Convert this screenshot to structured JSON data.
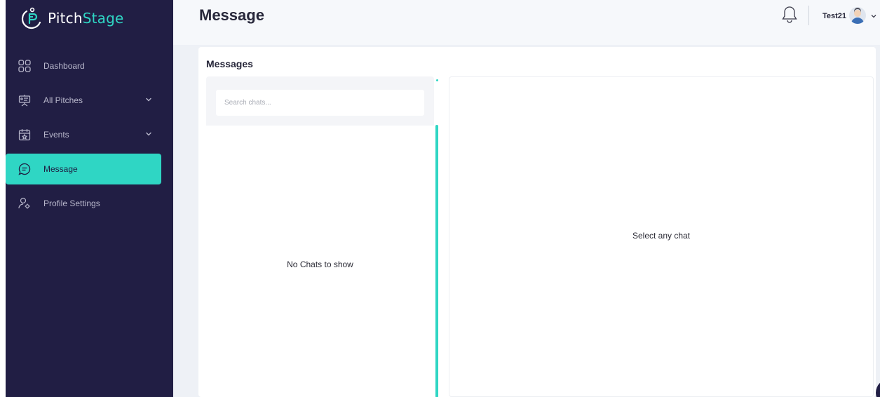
{
  "brand": {
    "name_part1": "Pitch",
    "name_part2": "Stage",
    "accent": "#2fd6c4",
    "sidebar_bg": "#211e44"
  },
  "sidebar": {
    "items": [
      {
        "label": "Dashboard",
        "icon": "grid-icon",
        "has_chevron": false,
        "active": false
      },
      {
        "label": "All Pitches",
        "icon": "presentation-icon",
        "has_chevron": true,
        "active": false
      },
      {
        "label": "Events",
        "icon": "calendar-icon",
        "has_chevron": true,
        "active": false
      },
      {
        "label": "Message",
        "icon": "chat-icon",
        "has_chevron": false,
        "active": true
      },
      {
        "label": "Profile Settings",
        "icon": "user-settings-icon",
        "has_chevron": false,
        "active": false
      }
    ]
  },
  "header": {
    "title": "Message",
    "user_name": "Test21",
    "bell_icon": "bell-icon",
    "avatar_icon": "avatar-icon"
  },
  "messages": {
    "card_title": "Messages",
    "search_placeholder": "Search chats...",
    "empty_list_text": "No Chats to show",
    "empty_chat_text": "Select any chat"
  }
}
